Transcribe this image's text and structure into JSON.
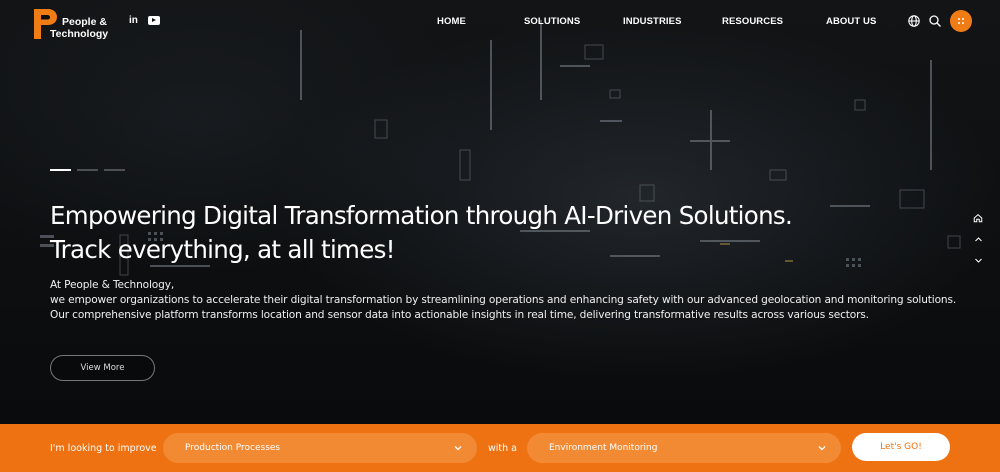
{
  "brand": {
    "logo_text_line1": "People &",
    "logo_text_line2": "Technology",
    "accent_color": "#ee7212"
  },
  "social": {
    "linkedin_label": "in",
    "youtube_icon": "youtube-icon"
  },
  "nav": {
    "items": [
      {
        "label": "HOME"
      },
      {
        "label": "SOLUTIONS"
      },
      {
        "label": "INDUSTRIES"
      },
      {
        "label": "RESOURCES"
      },
      {
        "label": "ABOUT US"
      }
    ],
    "icons": [
      "globe-icon",
      "search-icon",
      "menu-icon"
    ]
  },
  "hero": {
    "slides_total": 3,
    "active_slide": 1,
    "headline_line1": "Empowering Digital Transformation through AI-Driven Solutions.",
    "headline_line2": "Track everything, at all times!",
    "intro_line1": "At People & Technology,",
    "intro_line2": "we empower organizations to accelerate their digital transformation by streamlining operations and enhancing safety with our advanced geolocation and monitoring solutions.",
    "intro_line3": "Our comprehensive platform transforms location and sensor data into actionable insights in real time, delivering transformative results across various sectors.",
    "cta_label": "View More",
    "side_icons": [
      "home-icon",
      "chevron-up-icon",
      "chevron-down-icon"
    ]
  },
  "finder": {
    "prefix_label": "I'm looking to improve",
    "first_select_value": "Production Processes",
    "middle_label": "with a",
    "second_select_value": "Environment Monitoring",
    "go_label": "Let's GO!"
  }
}
